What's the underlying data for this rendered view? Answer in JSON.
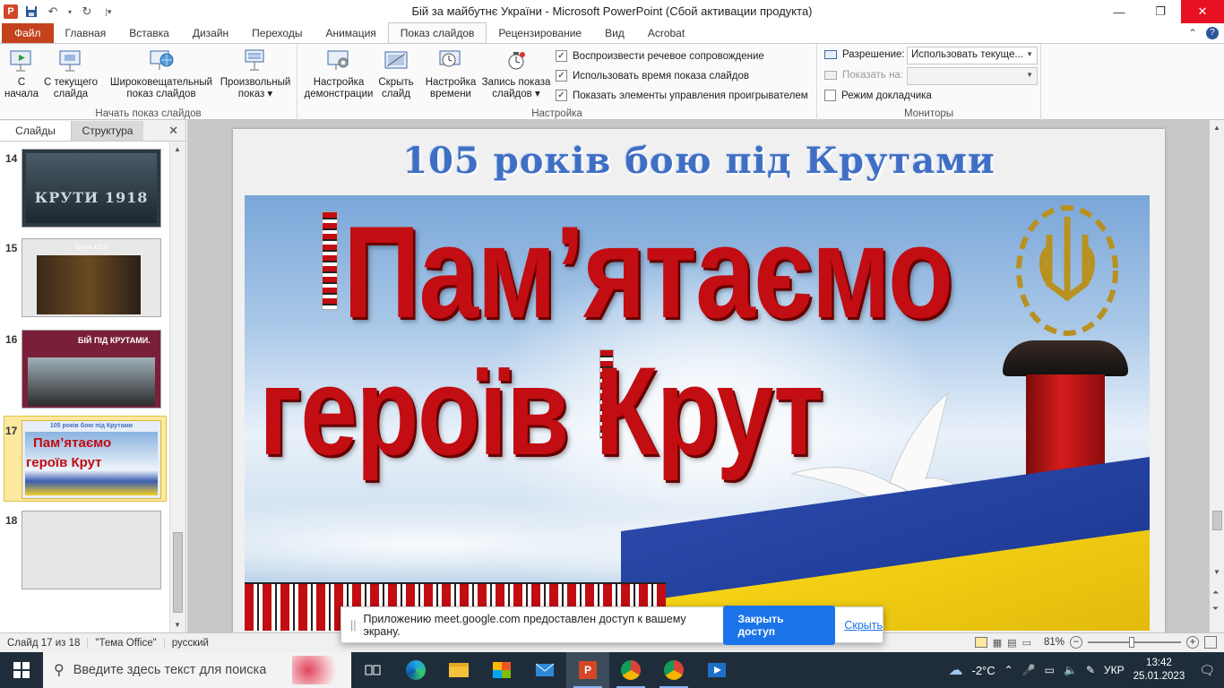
{
  "window": {
    "title": "Бій за майбутнє України  -  Microsoft PowerPoint (Сбой активации продукта)"
  },
  "tabs": [
    "Файл",
    "Главная",
    "Вставка",
    "Дизайн",
    "Переходы",
    "Анимация",
    "Показ слайдов",
    "Рецензирование",
    "Вид",
    "Acrobat"
  ],
  "active_tab": "Показ слайдов",
  "ribbon": {
    "group_start": {
      "label": "Начать показ слайдов",
      "buttons": [
        {
          "line1": "С",
          "line2": "начала"
        },
        {
          "line1": "С текущего",
          "line2": "слайда"
        },
        {
          "line1": "Широковещательный",
          "line2": "показ слайдов"
        },
        {
          "line1": "Произвольный",
          "line2": "показ ▾"
        }
      ]
    },
    "group_setup": {
      "label": "Настройка",
      "buttons": [
        {
          "line1": "Настройка",
          "line2": "демонстрации"
        },
        {
          "line1": "Скрыть",
          "line2": "слайд"
        },
        {
          "line1": "Настройка",
          "line2": "времени"
        },
        {
          "line1": "Запись показа",
          "line2": "слайдов ▾"
        }
      ],
      "checkboxes": [
        {
          "label": "Воспроизвести речевое сопровождение",
          "checked": true
        },
        {
          "label": "Использовать время показа слайдов",
          "checked": true
        },
        {
          "label": "Показать элементы управления проигрывателем",
          "checked": true
        }
      ]
    },
    "group_monitors": {
      "label": "Мониторы",
      "resolution_label": "Разрешение:",
      "resolution_value": "Использовать текуще...",
      "show_on_label": "Показать на:",
      "show_on_value": "",
      "presenter_mode_label": "Режим докладчика",
      "presenter_mode_checked": false
    }
  },
  "slides_panel": {
    "tab_slides": "Слайды",
    "tab_outline": "Структура",
    "close_symbol": "✕",
    "slides": [
      {
        "num": "14",
        "caption": "КРУТИ 1918"
      },
      {
        "num": "15",
        "caption": "Крути 1918"
      },
      {
        "num": "16",
        "caption": "БІЙ ПІД КРУТАМИ."
      },
      {
        "num": "17",
        "caption_top": "105 років бою під Крутами",
        "caption_l1": "Пам’ятаємо",
        "caption_l2": "героїв Крут",
        "selected": true
      },
      {
        "num": "18",
        "caption": ""
      }
    ]
  },
  "slide": {
    "title": "105 років бою під Крутами",
    "poster_line1": "Пам’ятаємо",
    "poster_line2": "героїв Крут"
  },
  "status": {
    "slide_info": "Слайд 17 из 18",
    "theme": "\"Тема Office\"",
    "language": "русский",
    "zoom": "81%",
    "zoom_fraction": 0.81
  },
  "notice": {
    "text": "Приложению meet.google.com предоставлен доступ к вашему экрану.",
    "button": "Закрыть доступ",
    "link": "Скрыть"
  },
  "taskbar": {
    "search_placeholder": "Введите здесь текст для поиска",
    "weather": "-2°C",
    "lang": "УКР",
    "time": "13:42",
    "date": "25.01.2023"
  },
  "colors": {
    "accent_file": "#c4421d",
    "title_blue": "#3f6fc4",
    "poster_red": "#c20d12",
    "notice_blue": "#1a73e8",
    "taskbar": "#1f2d3a"
  }
}
